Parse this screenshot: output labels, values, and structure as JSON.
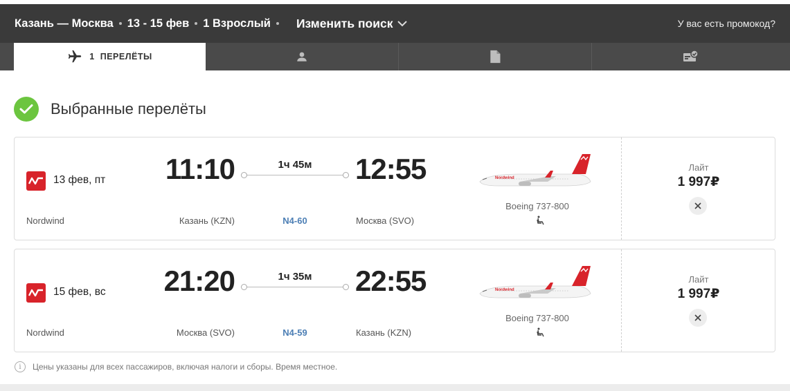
{
  "header": {
    "route": "Казань — Москва",
    "dates": "13 - 15 фев",
    "passengers": "1 Взрослый",
    "change_search": "Изменить поиск",
    "promo": "У вас есть промокод?"
  },
  "tabs": [
    {
      "icon": "airplane-icon",
      "number": "1",
      "label": "ПЕРЕЛЁТЫ"
    },
    {
      "icon": "person-icon"
    },
    {
      "icon": "document-icon"
    },
    {
      "icon": "ticket-check-icon"
    }
  ],
  "section_title": "Выбранные перелёты",
  "flights": [
    {
      "date": "13 фев, пт",
      "airline": "Nordwind",
      "dep_time": "11:10",
      "dep_city": "Казань (KZN)",
      "duration": "1ч 45м",
      "flight_no": "N4-60",
      "arr_time": "12:55",
      "arr_city": "Москва (SVO)",
      "aircraft": "Boeing 737-800",
      "fare": "Лайт",
      "price": "1 997₽"
    },
    {
      "date": "15 фев, вс",
      "airline": "Nordwind",
      "dep_time": "21:20",
      "dep_city": "Москва (SVO)",
      "duration": "1ч 35м",
      "flight_no": "N4-59",
      "arr_time": "22:55",
      "arr_city": "Казань (KZN)",
      "aircraft": "Boeing 737-800",
      "fare": "Лайт",
      "price": "1 997₽"
    }
  ],
  "note": "Цены указаны для всех пассажиров, включая налоги и сборы. Время местное.",
  "colors": {
    "header_bg": "#3a3a3a",
    "tabs_bg": "#4a4a4a",
    "check_green": "#6cc53f",
    "nordwind_red": "#d8232a",
    "flight_link": "#4d7fb5"
  }
}
